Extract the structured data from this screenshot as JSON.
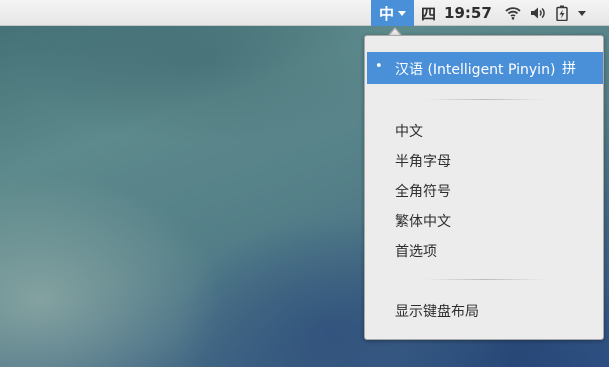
{
  "topbar": {
    "input_indicator": "中",
    "weekday": "四",
    "time": "19:57",
    "icons": [
      "wifi-icon",
      "volume-icon",
      "battery-icon",
      "menu-caret-icon"
    ]
  },
  "popup": {
    "active_input": {
      "bullet": "•",
      "label": "汉语 (Intelligent Pinyin)",
      "mode": "拼"
    },
    "options": [
      "中文",
      "半角字母",
      "全角符号",
      "繁体中文",
      "首选项"
    ],
    "show_keyboard_layout": "显示键盘布局"
  },
  "colors": {
    "accent": "#4a90d9",
    "menu_bg": "#ececec",
    "topbar_bg": "#e9e9e9"
  }
}
